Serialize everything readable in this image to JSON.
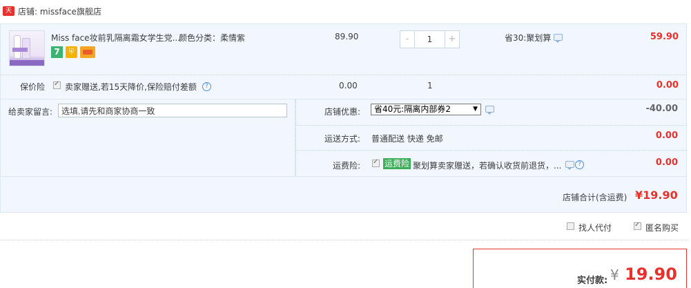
{
  "store": {
    "badge": "天猫",
    "label": "店铺: missface旗舰店"
  },
  "item": {
    "title": "Miss face妆前乳隔离霜女学生党...",
    "spec": "颜色分类：柔情紫",
    "price": "89.90",
    "quantity": "1",
    "qty_minus": "-",
    "qty_plus": "+",
    "discount": "省30:聚划算",
    "subtotal": "59.90",
    "service_icons": [
      "seven-day-return-icon",
      "guarantee-shield-icon",
      "credit-card-icon"
    ],
    "service_badge_7": "7",
    "service_badge_shield": "⛨"
  },
  "price_insurance": {
    "label": "保价险",
    "text": "卖家赠送,若15天降价,保险赔付差额",
    "price": "0.00",
    "quantity": "1",
    "total": "0.00"
  },
  "note": {
    "label": "给卖家留言:",
    "value": "选填,请先和商家协商一致"
  },
  "coupon": {
    "label": "店铺优惠:",
    "selected": "省40元:隔离内部券2",
    "amount": "-40.00"
  },
  "shipping": {
    "label": "运送方式:",
    "value": "普通配送 快递 免邮",
    "amount": "0.00"
  },
  "freight_insurance": {
    "label": "运费险:",
    "badge": "运费险",
    "text": "聚划算卖家赠送，若确认收货前退货，...",
    "amount": "0.00"
  },
  "store_total": {
    "label": "店铺合计(含运费)",
    "value": "¥19.90"
  },
  "options": {
    "friend_pay": "找人代付",
    "anonymous": "匿名购买",
    "anonymous_checked": true,
    "friend_checked": false
  },
  "payment": {
    "label": "实付款:",
    "currency": "¥",
    "value": "19.90"
  },
  "colors": {
    "accent_red": "#e5322d",
    "panel_blue": "#f2f7ff",
    "green_badge": "#3cae5a"
  }
}
